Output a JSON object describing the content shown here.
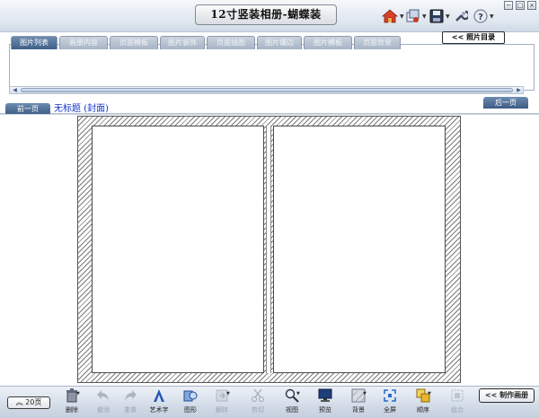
{
  "window": {
    "title": "12寸竖装相册-蝴蝶装",
    "toolbar_icons": [
      "home-icon",
      "photo-tools-icon",
      "save-icon",
      "wrench-icon",
      "help-icon"
    ],
    "window_controls": [
      "−",
      "□",
      "×"
    ]
  },
  "tabs": [
    {
      "label": "图片列表",
      "active": true
    },
    {
      "label": "画册内容",
      "active": false
    },
    {
      "label": "页面模板",
      "active": false
    },
    {
      "label": "图片装饰",
      "active": false
    },
    {
      "label": "页面插图",
      "active": false
    },
    {
      "label": "图片镶边",
      "active": false
    },
    {
      "label": "图片模板",
      "active": false
    },
    {
      "label": "页面背景",
      "active": false
    }
  ],
  "photo_catalog_button": "<< 照片目录",
  "scroll": {
    "left": "◀",
    "right": "▶"
  },
  "nav": {
    "prev_label": "前一页",
    "next_label": "后一页",
    "page_title": "无标题 (封面)"
  },
  "bottom": {
    "pages_button": "︽ 20页",
    "make_album_button": "<< 制作画册",
    "tools": [
      {
        "label": "删除",
        "icon": "trash-icon",
        "enabled": true,
        "dropdown": true
      },
      {
        "label": "撤消",
        "icon": "undo-icon",
        "enabled": false,
        "dropdown": false
      },
      {
        "label": "重做",
        "icon": "redo-icon",
        "enabled": false,
        "dropdown": false
      },
      {
        "label": "艺术字",
        "icon": "art-text-icon",
        "enabled": true,
        "dropdown": false
      },
      {
        "label": "图形",
        "icon": "shapes-icon",
        "enabled": true,
        "dropdown": false
      },
      {
        "label": "翻转",
        "icon": "flip-icon",
        "enabled": false,
        "dropdown": true
      },
      {
        "label": "剪切",
        "icon": "scissors-icon",
        "enabled": false,
        "dropdown": false
      },
      {
        "label": "视图",
        "icon": "magnifier-icon",
        "enabled": true,
        "dropdown": true
      },
      {
        "label": "预览",
        "icon": "monitor-icon",
        "enabled": true,
        "dropdown": false
      },
      {
        "label": "背景",
        "icon": "background-icon",
        "enabled": true,
        "dropdown": true
      },
      {
        "label": "全屏",
        "icon": "fullscreen-icon",
        "enabled": true,
        "dropdown": false
      },
      {
        "label": "顺序",
        "icon": "order-icon",
        "enabled": true,
        "dropdown": true
      },
      {
        "label": "组合",
        "icon": "group-icon",
        "enabled": false,
        "dropdown": false
      }
    ]
  }
}
